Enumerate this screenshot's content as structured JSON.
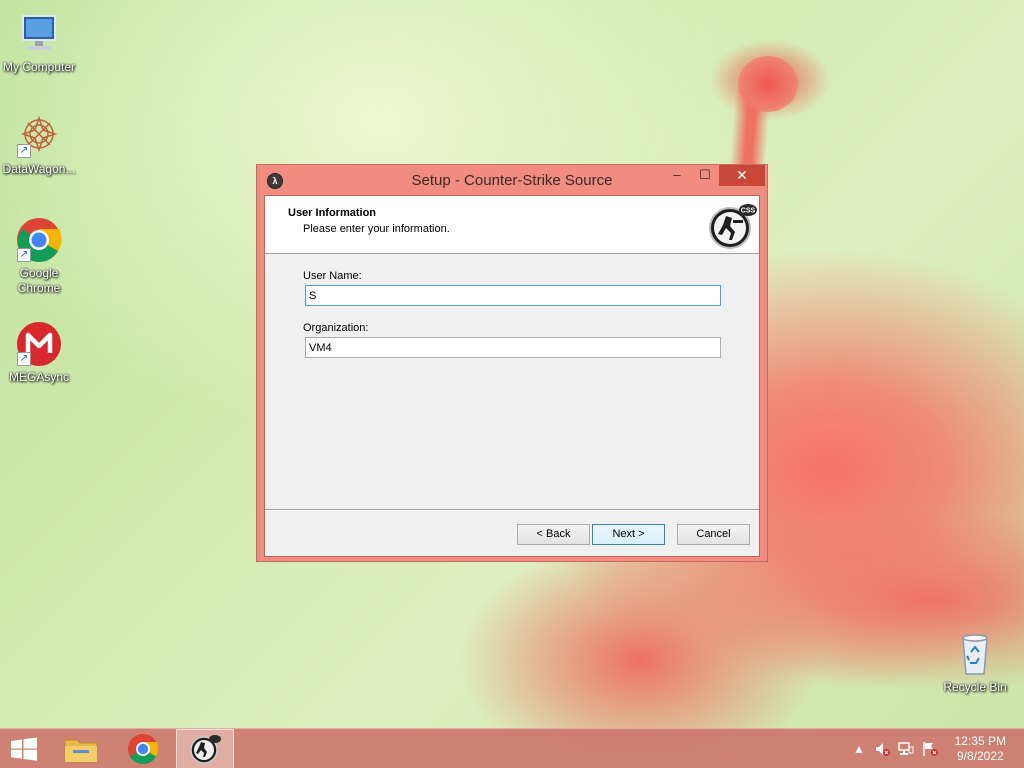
{
  "desktop": {
    "icons": [
      {
        "label": "My Computer",
        "icon": "computer-icon"
      },
      {
        "label": "DataWagon...",
        "icon": "datawagon-icon"
      },
      {
        "label": "Google Chrome",
        "icon": "chrome-icon"
      },
      {
        "label": "MEGAsync",
        "icon": "mega-icon"
      },
      {
        "label": "Recycle Bin",
        "icon": "recycle-bin-icon"
      }
    ]
  },
  "dialog": {
    "title": "Setup - Counter-Strike Source",
    "controls": {
      "minimize": "–",
      "maximize": "☐",
      "close": "✕"
    },
    "header": {
      "title": "User Information",
      "subtitle": "Please enter your information.",
      "logo_text": "CSS"
    },
    "fields": {
      "user_name": {
        "label": "User Name:",
        "value": "S"
      },
      "organization": {
        "label": "Organization:",
        "value": "VM4"
      }
    },
    "buttons": {
      "back": "< Back",
      "next": "Next >",
      "cancel": "Cancel"
    }
  },
  "taskbar": {
    "items": [
      "start-button",
      "file-explorer",
      "google-chrome",
      "counter-strike-setup"
    ],
    "active_item": "counter-strike-setup",
    "clock": {
      "time": "12:35 PM",
      "date": "9/8/2022"
    },
    "colors": {
      "taskbar": "#cd786e",
      "accent": "#c7473a"
    }
  }
}
